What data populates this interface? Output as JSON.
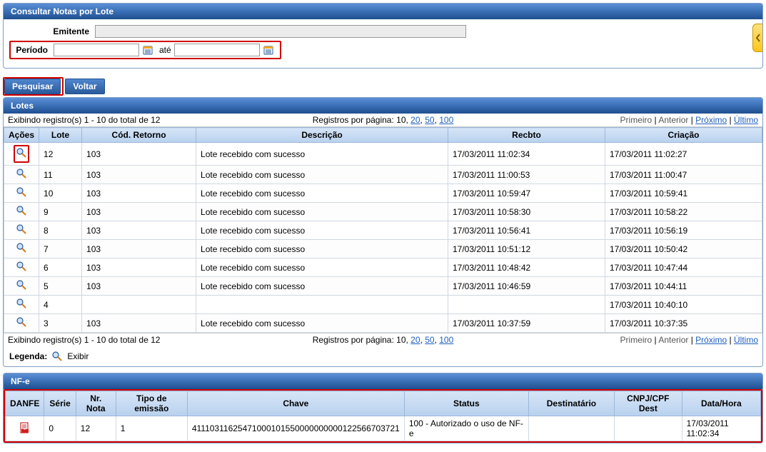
{
  "filterPanel": {
    "title": "Consultar Notas por Lote",
    "emitenteLabel": "Emitente",
    "periodoLabel": "Período",
    "ateLabel": "até",
    "pesquisar": "Pesquisar",
    "voltar": "Voltar"
  },
  "lotesPanel": {
    "title": "Lotes",
    "pagerLeft": "Exibindo registro(s) 1 - 10 do total de 12",
    "pagerCenterPrefix": "Registros por página: 10, ",
    "pagerOpt20": "20",
    "pagerSep1": ", ",
    "pagerOpt50": "50",
    "pagerSep2": ", ",
    "pagerOpt100": "100",
    "pagerPrimeiro": "Primeiro",
    "pagerAnterior": "Anterior",
    "pagerProximo": "Próximo",
    "pagerUltimo": "Último",
    "headers": {
      "acoes": "Ações",
      "lote": "Lote",
      "cod": "Cód. Retorno",
      "desc": "Descrição",
      "recbto": "Recbto",
      "criacao": "Criação"
    },
    "rows": [
      {
        "lote": "12",
        "cod": "103",
        "desc": "Lote recebido com sucesso",
        "recbto": "17/03/2011 11:02:34",
        "criacao": "17/03/2011 11:02:27"
      },
      {
        "lote": "11",
        "cod": "103",
        "desc": "Lote recebido com sucesso",
        "recbto": "17/03/2011 11:00:53",
        "criacao": "17/03/2011 11:00:47"
      },
      {
        "lote": "10",
        "cod": "103",
        "desc": "Lote recebido com sucesso",
        "recbto": "17/03/2011 10:59:47",
        "criacao": "17/03/2011 10:59:41"
      },
      {
        "lote": "9",
        "cod": "103",
        "desc": "Lote recebido com sucesso",
        "recbto": "17/03/2011 10:58:30",
        "criacao": "17/03/2011 10:58:22"
      },
      {
        "lote": "8",
        "cod": "103",
        "desc": "Lote recebido com sucesso",
        "recbto": "17/03/2011 10:56:41",
        "criacao": "17/03/2011 10:56:19"
      },
      {
        "lote": "7",
        "cod": "103",
        "desc": "Lote recebido com sucesso",
        "recbto": "17/03/2011 10:51:12",
        "criacao": "17/03/2011 10:50:42"
      },
      {
        "lote": "6",
        "cod": "103",
        "desc": "Lote recebido com sucesso",
        "recbto": "17/03/2011 10:48:42",
        "criacao": "17/03/2011 10:47:44"
      },
      {
        "lote": "5",
        "cod": "103",
        "desc": "Lote recebido com sucesso",
        "recbto": "17/03/2011 10:46:59",
        "criacao": "17/03/2011 10:44:11"
      },
      {
        "lote": "4",
        "cod": "",
        "desc": "",
        "recbto": "",
        "criacao": "17/03/2011 10:40:10"
      },
      {
        "lote": "3",
        "cod": "103",
        "desc": "Lote recebido com sucesso",
        "recbto": "17/03/2011 10:37:59",
        "criacao": "17/03/2011 10:37:35"
      }
    ],
    "legendaLabel": "Legenda:",
    "legendaExibir": "Exibir"
  },
  "nfePanel": {
    "title": "NF-e",
    "headers": {
      "danfe": "DANFE",
      "serie": "Série",
      "nrnota": "Nr. Nota",
      "tipo": "Tipo de emissão",
      "chave": "Chave",
      "status": "Status",
      "dest": "Destinatário",
      "cnpj": "CNPJ/CPF Dest",
      "datahora": "Data/Hora"
    },
    "row": {
      "serie": "0",
      "nrnota": "12",
      "tipo": "1",
      "chave": "41110311625471000101550000000000122566703721",
      "status": "100 - Autorizado o uso de NF-e",
      "dest": "",
      "cnpj": "",
      "datahora": "17/03/2011 11:02:34"
    }
  }
}
